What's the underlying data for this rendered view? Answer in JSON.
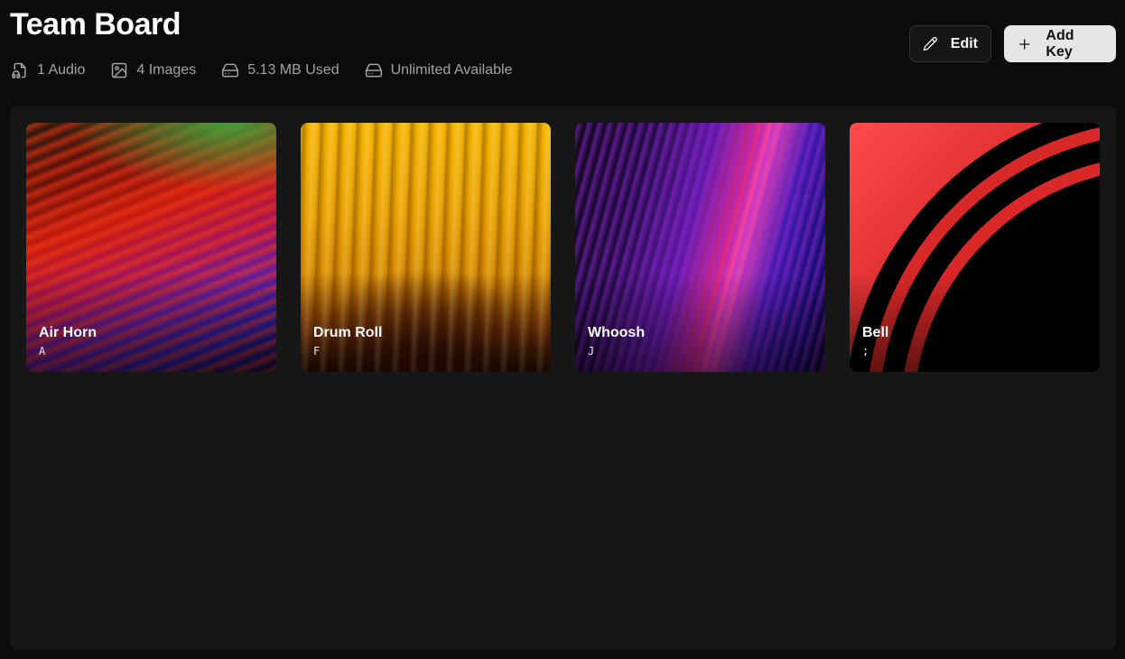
{
  "header": {
    "title": "Team Board",
    "stats": [
      {
        "icon": "audio-file-icon",
        "label": "1 Audio"
      },
      {
        "icon": "image-icon",
        "label": "4 Images"
      },
      {
        "icon": "hard-drive-icon",
        "label": "5.13 MB Used"
      },
      {
        "icon": "hard-drive-icon",
        "label": "Unlimited Available"
      }
    ]
  },
  "actions": {
    "edit_label": "Edit",
    "add_key_label": "Add Key"
  },
  "cards": [
    {
      "name": "Air Horn",
      "key": "A"
    },
    {
      "name": "Drum Roll",
      "key": "F"
    },
    {
      "name": "Whoosh",
      "key": "J"
    },
    {
      "name": "Bell",
      "key": ";"
    }
  ],
  "colors": {
    "page_bg": "#0b0b0b",
    "board_bg": "#161616",
    "muted_text": "#a3a3a3",
    "primary_button_bg": "#e6e6e6"
  }
}
